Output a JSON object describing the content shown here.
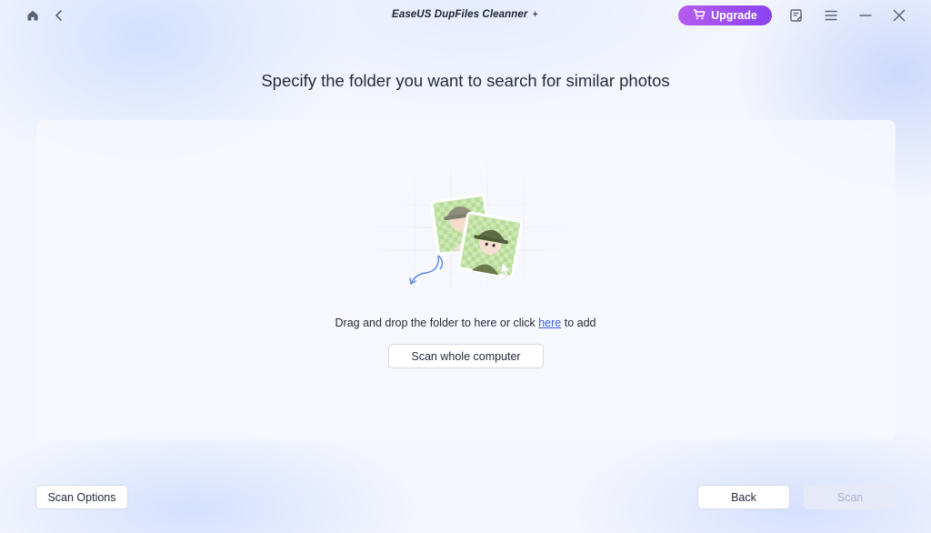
{
  "titlebar": {
    "app_title": "EaseUS DupFiles Cleanner",
    "sparkle_glyph": "✦",
    "upgrade_label": "Upgrade",
    "icons": [
      "home-icon",
      "back-chevron-icon",
      "sparkle-icon",
      "cart-icon",
      "feedback-icon",
      "menu-icon",
      "minimize-icon",
      "close-icon"
    ]
  },
  "main": {
    "heading": "Specify the folder you want to search for similar photos",
    "drop_text_before": "Drag and drop the folder to here or click ",
    "drop_link": "here",
    "drop_text_after": " to add",
    "scan_whole_label": "Scan whole computer"
  },
  "footer": {
    "scan_options_label": "Scan Options",
    "back_label": "Back",
    "scan_label": "Scan"
  },
  "colors": {
    "upgrade_gradient_start": "#b55cf0",
    "upgrade_gradient_end": "#8a43f0",
    "link": "#3a5fe0",
    "scan_disabled_bg": "#e6eaf8",
    "scan_disabled_text": "#a9b2cf"
  }
}
